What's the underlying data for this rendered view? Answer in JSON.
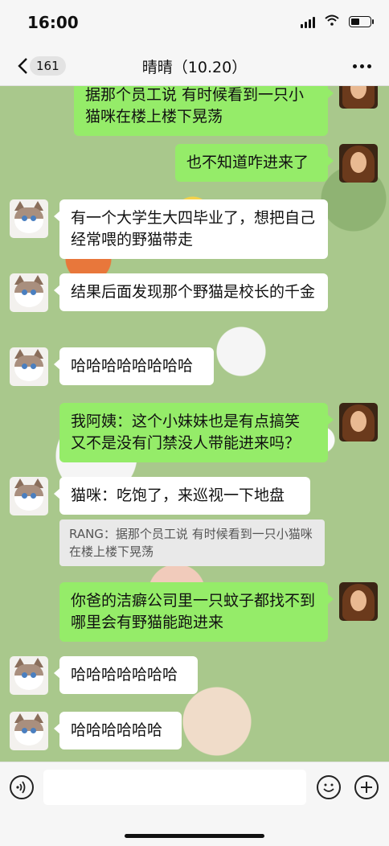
{
  "status_bar": {
    "time": "16:00"
  },
  "nav": {
    "back_count": "161",
    "title": "晴晴（10.20）"
  },
  "messages": [
    {
      "side": "right",
      "text": "据那个员工说 有时候看到一只小猫咪在楼上楼下晃荡"
    },
    {
      "side": "right",
      "text": "也不知道咋进来了"
    },
    {
      "side": "left",
      "text": "有一个大学生大四毕业了，想把自己经常喂的野猫带走"
    },
    {
      "side": "left",
      "text": "结果后面发现那个野猫是校长的千金"
    },
    {
      "side": "left",
      "text": "哈哈哈哈哈哈哈哈"
    },
    {
      "side": "right",
      "text": "我阿姨：这个小妹妹也是有点搞笑 又不是没有门禁没人带能进来吗？"
    },
    {
      "side": "left",
      "text": "猫咪：吃饱了，来巡视一下地盘",
      "quote": "RANG：据那个员工说 有时候看到一只小猫咪在楼上楼下晃荡"
    },
    {
      "side": "right",
      "text": "你爸的洁癖公司里一只蚊子都找不到哪里会有野猫能跑进来"
    },
    {
      "side": "left",
      "text": "哈哈哈哈哈哈哈"
    },
    {
      "side": "left",
      "text": "哈哈哈哈哈哈"
    }
  ],
  "icons": {
    "back": "chevron-left-icon",
    "more": "more-dots-icon",
    "voice": "voice-icon",
    "emoji": "emoji-icon",
    "add": "plus-icon"
  },
  "colors": {
    "sent_bubble": "#95ec69",
    "received_bubble": "#ffffff",
    "bar_bg": "#f6f6f6"
  }
}
